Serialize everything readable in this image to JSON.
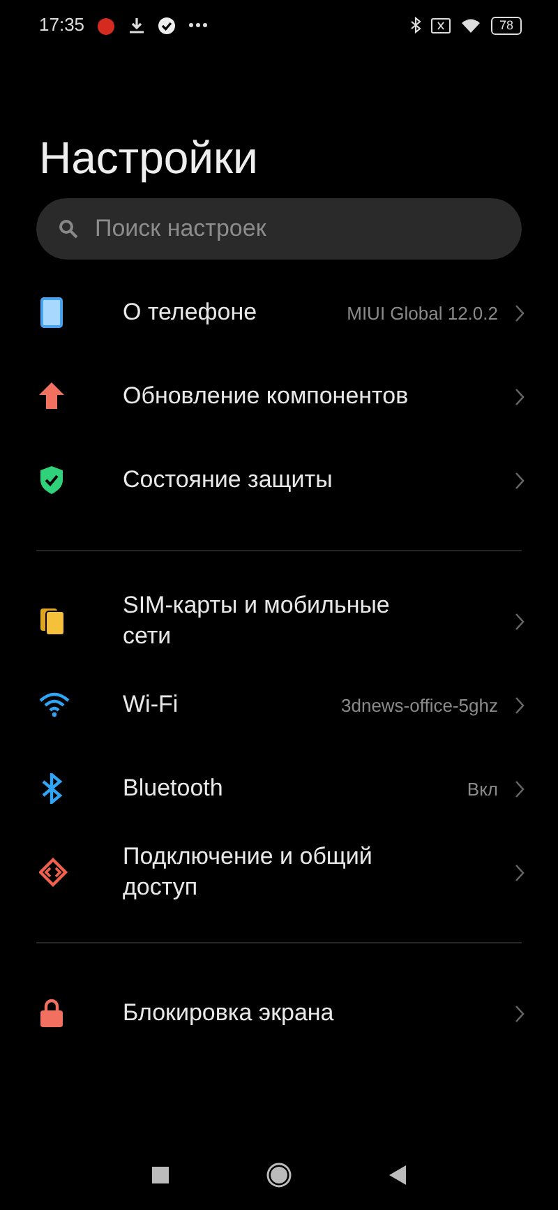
{
  "status_bar": {
    "time": "17:35",
    "battery": "78"
  },
  "title": "Настройки",
  "search": {
    "placeholder": "Поиск настроек"
  },
  "sections": [
    {
      "items": [
        {
          "kind": "phone",
          "label": "О телефоне",
          "value": "MIUI Global 12.0.2"
        },
        {
          "kind": "update",
          "label": "Обновление компонентов"
        },
        {
          "kind": "shield",
          "label": "Состояние защиты"
        }
      ]
    },
    {
      "items": [
        {
          "kind": "sim",
          "label": "SIM-карты и мобильные сети"
        },
        {
          "kind": "wifi",
          "label": "Wi-Fi",
          "value": "3dnews-office-5ghz"
        },
        {
          "kind": "bluetooth",
          "label": "Bluetooth",
          "value": "Вкл"
        },
        {
          "kind": "share",
          "label": "Подключение и общий доступ"
        }
      ]
    },
    {
      "items": [
        {
          "kind": "lock",
          "label": "Блокировка экрана"
        }
      ]
    }
  ]
}
